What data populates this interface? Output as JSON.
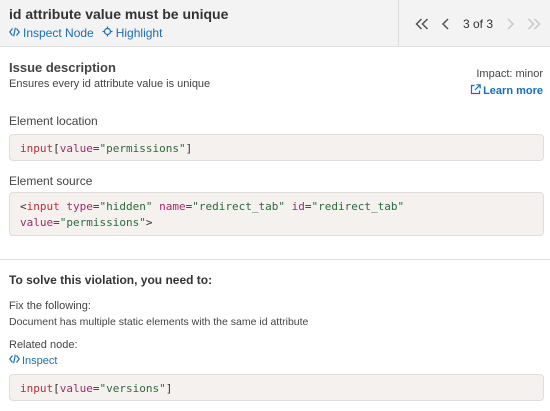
{
  "header": {
    "title": "id attribute value must be unique",
    "inspect_label": "Inspect Node",
    "highlight_label": "Highlight",
    "pager_text": "3 of 3"
  },
  "issue": {
    "title": "Issue description",
    "description": "Ensures every id attribute value is unique",
    "impact": "Impact: minor",
    "learn_more": "Learn more"
  },
  "element_location": {
    "label": "Element location",
    "tag": "input",
    "open": "[",
    "attr": "value",
    "eq": "=",
    "value": "\"permissions\"",
    "close": "]"
  },
  "element_source": {
    "label": "Element source",
    "lt": "<",
    "tag": "input",
    "a1": "type",
    "v1": "\"hidden\"",
    "a2": "name",
    "v2": "\"redirect_tab\"",
    "a3": "id",
    "v3": "\"redirect_tab\"",
    "a4": "value",
    "v4": "\"permissions\"",
    "eq": "=",
    "gt": ">"
  },
  "solve": {
    "title": "To solve this violation, you need to:",
    "fix_label": "Fix the following:",
    "fix_text": "Document has multiple static elements with the same id attribute",
    "related_label": "Related node:",
    "inspect_label": "Inspect"
  },
  "related_node": {
    "tag": "input",
    "open": "[",
    "attr": "value",
    "eq": "=",
    "value": "\"versions\"",
    "close": "]"
  },
  "colors": {
    "link": "#1a6fb0",
    "code_bg": "#f4f1ee",
    "tag": "#b5303c",
    "string": "#2a6b3c"
  }
}
